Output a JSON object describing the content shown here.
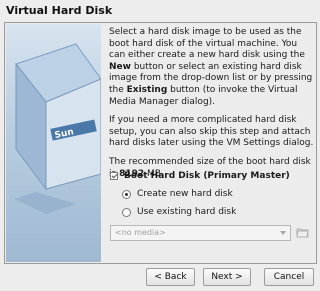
{
  "window": {
    "title": "Virtual Hard Disk"
  },
  "body": {
    "p1_before_new": "Select a hard disk image to be used as the boot hard disk of the virtual machine. You can either create a new hard disk using the ",
    "p1_new": "New",
    "p1_between": " button or select an existing hard disk image from the drop-down list or by pressing the ",
    "p1_existing": "Existing",
    "p1_after": " button (to invoke the Virtual Media Manager dialog).",
    "p2": "If you need a more complicated hard disk setup, you can also skip this step and attach hard disks later using the VM Settings dialog.",
    "p3_before": "The recommended size of the boot hard disk is ",
    "p3_size": "8192",
    "p3_after": " MB."
  },
  "options": {
    "boot_checkbox_label": "Boot Hard Disk (Primary Master)",
    "boot_checkbox_checked": true,
    "create_new_label": "Create new hard disk",
    "use_existing_label": "Use existing hard disk",
    "selected": "create_new"
  },
  "media_combo": {
    "value": "<no media>"
  },
  "buttons": {
    "back": "< Back",
    "next": "Next >",
    "cancel": "Cancel"
  },
  "icons": {
    "folder": "folder-open-icon",
    "logo": "virtualbox-cube-icon"
  }
}
